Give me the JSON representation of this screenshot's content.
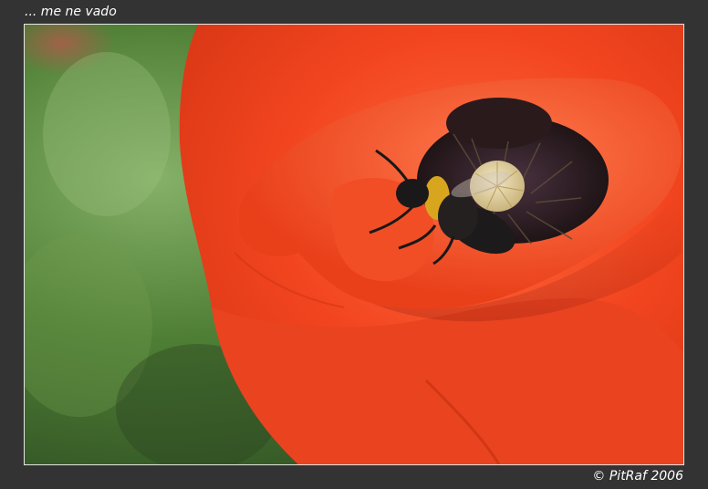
{
  "header": {
    "title": "... me ne vado"
  },
  "footer": {
    "credit": "© PitRaf 2006"
  },
  "photo": {
    "subject": "bumblebee on red poppy flower",
    "colors": {
      "background_green": "#4f7f35",
      "petal_red": "#f2451f",
      "petal_dark": "#c42c12",
      "center_dark": "#2b1a1c",
      "bee_yellow": "#d8a51e",
      "bee_black": "#1c1a1a",
      "seed_pod": "#e5d4a5"
    }
  }
}
